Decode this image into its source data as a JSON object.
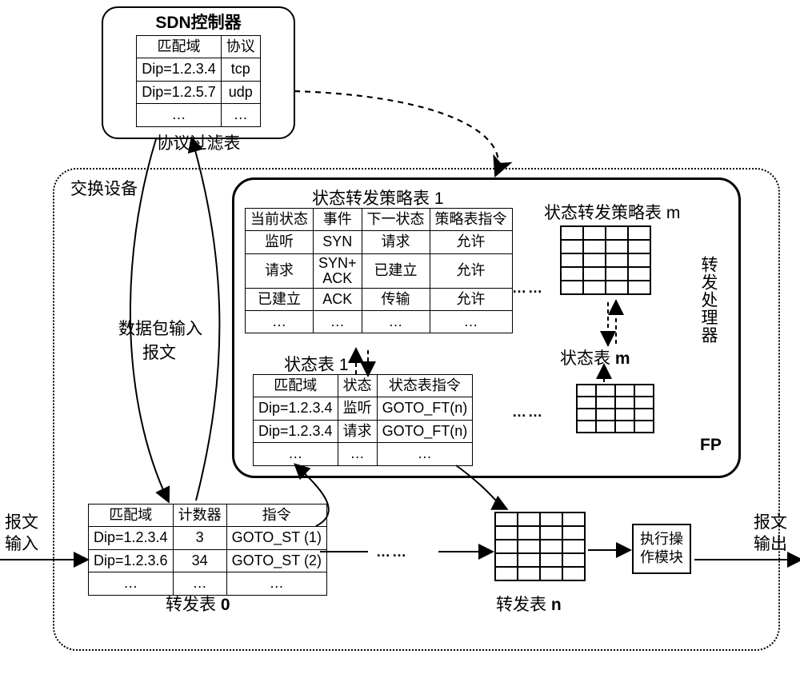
{
  "sdn": {
    "title": "SDN控制器",
    "filter_label": "协议过滤表",
    "cols": {
      "match": "匹配域",
      "proto": "协议"
    },
    "rows": [
      {
        "match": "Dip=1.2.3.4",
        "proto": "tcp"
      },
      {
        "match": "Dip=1.2.5.7",
        "proto": "udp"
      }
    ],
    "dots": "…"
  },
  "switch_label": "交换设备",
  "fp": {
    "title": "状态转发策略表 1",
    "cols": {
      "cur": "当前状态",
      "evt": "事件",
      "nxt": "下一状态",
      "instr": "策略表指令"
    },
    "rows": [
      {
        "cur": "监听",
        "evt": "SYN",
        "nxt": "请求",
        "instr": "允许"
      },
      {
        "cur": "请求",
        "evt": "SYN+\nACK",
        "nxt": "已建立",
        "instr": "允许"
      },
      {
        "cur": "已建立",
        "evt": "ACK",
        "nxt": "传输",
        "instr": "允许"
      }
    ],
    "dots": "…",
    "state_table_title": "状态表 1",
    "state_cols": {
      "match": "匹配域",
      "state": "状态",
      "instr": "状态表指令"
    },
    "state_rows": [
      {
        "match": "Dip=1.2.3.4",
        "state": "监听",
        "instr": "GOTO_FT(n)"
      },
      {
        "match": "Dip=1.2.3.4",
        "state": "请求",
        "instr": "GOTO_FT(n)"
      }
    ],
    "policy_m_label": "状态转发策略表 m",
    "state_m_label": "状态表 m",
    "side_label": "转发处理器",
    "side_code": "FP",
    "inter_dots": "……"
  },
  "ft0": {
    "cols": {
      "match": "匹配域",
      "cnt": "计数器",
      "instr": "指令"
    },
    "rows": [
      {
        "match": "Dip=1.2.3.4",
        "cnt": "3",
        "instr": "GOTO_ST (1)"
      },
      {
        "match": "Dip=1.2.3.6",
        "cnt": "34",
        "instr": "GOTO_ST (2)"
      }
    ],
    "dots": "…",
    "label": "转发表 0"
  },
  "ftn_label": "转发表 n",
  "exec_label": "执行操\n作模块",
  "packet_in_label_line1": "数据包输入",
  "packet_in_label_line2": "报文",
  "in_label": "报文\n输入",
  "out_label": "报文\n输出",
  "inter_dots_lower": "……"
}
